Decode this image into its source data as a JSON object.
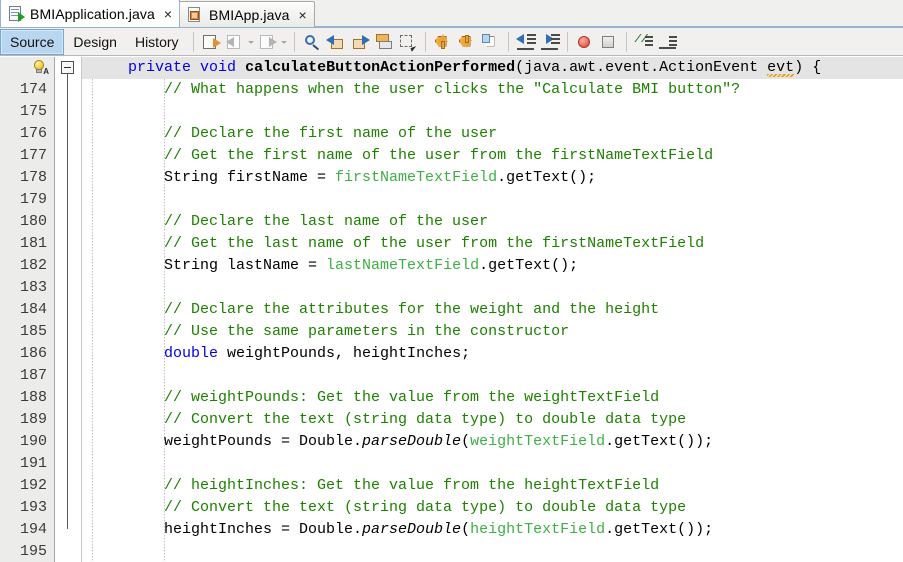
{
  "window": {
    "tabs": [
      {
        "label": "BMIApplication.java",
        "icon": "java-source-icon",
        "active": true,
        "close_label": "×"
      },
      {
        "label": "BMIApp.java",
        "icon": "java-form-icon",
        "active": false,
        "close_label": "×"
      }
    ]
  },
  "toolbar": {
    "view_tabs": [
      {
        "label": "Source",
        "selected": true
      },
      {
        "label": "Design",
        "selected": false
      },
      {
        "label": "History",
        "selected": false
      }
    ],
    "icons": [
      {
        "name": "last-edit-icon",
        "enabled": true
      },
      {
        "name": "back-navigate-icon",
        "enabled": false
      },
      {
        "name": "forward-navigate-icon",
        "enabled": false
      },
      {
        "name": "find-selection-icon",
        "enabled": true
      },
      {
        "name": "find-previous-icon",
        "enabled": true
      },
      {
        "name": "find-next-icon",
        "enabled": true
      },
      {
        "name": "toggle-highlight-icon",
        "enabled": true
      },
      {
        "name": "toggle-rectangular-selection-icon",
        "enabled": true
      },
      {
        "name": "previous-bookmark-icon",
        "enabled": true
      },
      {
        "name": "next-bookmark-icon",
        "enabled": true
      },
      {
        "name": "toggle-bookmark-icon",
        "enabled": true
      },
      {
        "name": "shift-line-left-icon",
        "enabled": true
      },
      {
        "name": "shift-line-right-icon",
        "enabled": true
      },
      {
        "name": "start-macro-recording-icon",
        "enabled": true
      },
      {
        "name": "stop-macro-recording-icon",
        "enabled": true
      },
      {
        "name": "comment-icon",
        "enabled": true
      },
      {
        "name": "uncomment-icon",
        "enabled": true
      }
    ]
  },
  "editor": {
    "gutter_hint": "hint-lightbulb-icon",
    "fold_marker": "collapse-method-icon",
    "first_line_number": 174,
    "line_numbers": [
      "174",
      "175",
      "176",
      "177",
      "178",
      "179",
      "180",
      "181",
      "182",
      "183",
      "184",
      "185",
      "186",
      "187",
      "188",
      "189",
      "190",
      "191",
      "192",
      "193",
      "194",
      "195"
    ],
    "lines": [
      {
        "n": "",
        "highlight": true,
        "tokens": [
          {
            "t": "    ",
            "c": "pl"
          },
          {
            "t": "private",
            "c": "k"
          },
          {
            "t": " ",
            "c": "pl"
          },
          {
            "t": "void",
            "c": "k"
          },
          {
            "t": " ",
            "c": "pl"
          },
          {
            "t": "calculateButtonActionPerformed",
            "c": "mn"
          },
          {
            "t": "(java.awt.event.ActionEvent ",
            "c": "pl"
          },
          {
            "t": "evt",
            "c": "pl squig"
          },
          {
            "t": ") {",
            "c": "pl"
          }
        ]
      },
      {
        "n": "174",
        "tokens": [
          {
            "t": "        // What happens when the user clicks the \"Calculate BMI button\"?",
            "c": "cm"
          }
        ]
      },
      {
        "n": "175",
        "tokens": []
      },
      {
        "n": "176",
        "tokens": [
          {
            "t": "        // Declare the first name of the user",
            "c": "cm"
          }
        ]
      },
      {
        "n": "177",
        "tokens": [
          {
            "t": "        // Get the first name of the user from the firstNameTextField",
            "c": "cm"
          }
        ]
      },
      {
        "n": "178",
        "tokens": [
          {
            "t": "        String firstName = ",
            "c": "pl"
          },
          {
            "t": "firstNameTextField",
            "c": "fld"
          },
          {
            "t": ".getText();",
            "c": "pl"
          }
        ]
      },
      {
        "n": "179",
        "tokens": []
      },
      {
        "n": "180",
        "tokens": [
          {
            "t": "        // Declare the last name of the user",
            "c": "cm"
          }
        ]
      },
      {
        "n": "181",
        "tokens": [
          {
            "t": "        // Get the last name of the user from the firstNameTextField",
            "c": "cm"
          }
        ]
      },
      {
        "n": "182",
        "tokens": [
          {
            "t": "        String lastName = ",
            "c": "pl"
          },
          {
            "t": "lastNameTextField",
            "c": "fld"
          },
          {
            "t": ".getText();",
            "c": "pl"
          }
        ]
      },
      {
        "n": "183",
        "tokens": []
      },
      {
        "n": "184",
        "tokens": [
          {
            "t": "        // Declare the attributes for the weight and the height",
            "c": "cm"
          }
        ]
      },
      {
        "n": "185",
        "tokens": [
          {
            "t": "        // Use the same parameters in the constructor",
            "c": "cm"
          }
        ]
      },
      {
        "n": "186",
        "tokens": [
          {
            "t": "        ",
            "c": "pl"
          },
          {
            "t": "double",
            "c": "k"
          },
          {
            "t": " weightPounds, heightInches;",
            "c": "pl"
          }
        ]
      },
      {
        "n": "187",
        "tokens": []
      },
      {
        "n": "188",
        "tokens": [
          {
            "t": "        // weightPounds: Get the value from the weightTextField",
            "c": "cm"
          }
        ]
      },
      {
        "n": "189",
        "tokens": [
          {
            "t": "        // Convert the text (string data type) to double data type",
            "c": "cm"
          }
        ]
      },
      {
        "n": "190",
        "tokens": [
          {
            "t": "        weightPounds = Double.",
            "c": "pl"
          },
          {
            "t": "parseDouble",
            "c": "st"
          },
          {
            "t": "(",
            "c": "pl"
          },
          {
            "t": "weightTextField",
            "c": "fld"
          },
          {
            "t": ".getText());",
            "c": "pl"
          }
        ]
      },
      {
        "n": "191",
        "tokens": []
      },
      {
        "n": "192",
        "tokens": [
          {
            "t": "        // heightInches: Get the value from the heightTextField",
            "c": "cm"
          }
        ]
      },
      {
        "n": "193",
        "tokens": [
          {
            "t": "        // Convert the text (string data type) to double data type",
            "c": "cm"
          }
        ]
      },
      {
        "n": "194",
        "tokens": [
          {
            "t": "        heightInches = Double.",
            "c": "pl"
          },
          {
            "t": "parseDouble",
            "c": "st"
          },
          {
            "t": "(",
            "c": "pl"
          },
          {
            "t": "heightTextField",
            "c": "fld"
          },
          {
            "t": ".getText());",
            "c": "pl"
          }
        ]
      },
      {
        "n": "195",
        "tokens": []
      }
    ]
  },
  "colors": {
    "keyword": "#0000e6",
    "comment": "#1d8000",
    "field": "#3cb043",
    "highlight_line": "#e4e4e4",
    "gutter_bg": "#ececeb",
    "selected_tab": "#b8d6f0",
    "warning_underline": "#e5a100"
  }
}
